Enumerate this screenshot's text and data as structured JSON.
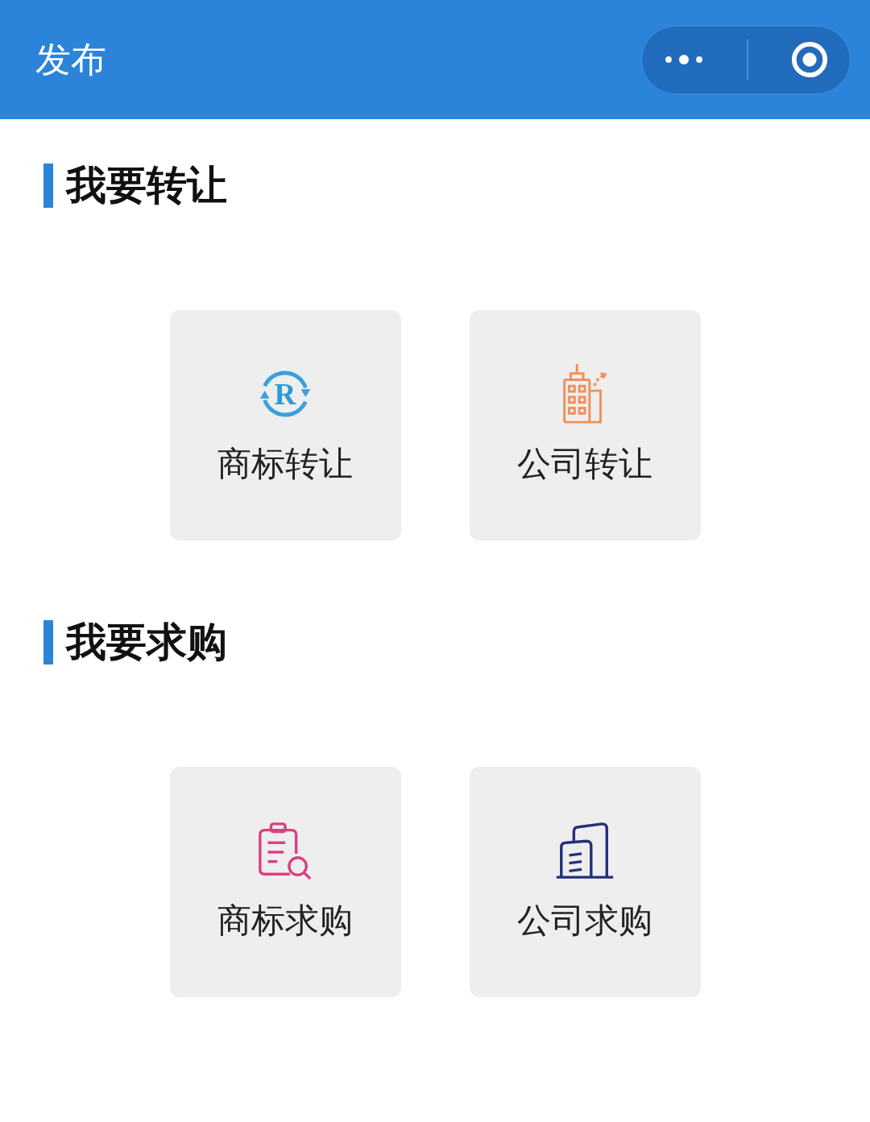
{
  "header": {
    "title": "发布"
  },
  "sections": [
    {
      "title": "我要转让",
      "items": [
        {
          "label": "商标转让",
          "kind": "trademark",
          "icon_text": "R"
        },
        {
          "label": "公司转让",
          "kind": "building"
        }
      ]
    },
    {
      "title": "我要求购",
      "items": [
        {
          "label": "商标求购",
          "kind": "search"
        },
        {
          "label": "公司求购",
          "kind": "office"
        }
      ]
    }
  ]
}
